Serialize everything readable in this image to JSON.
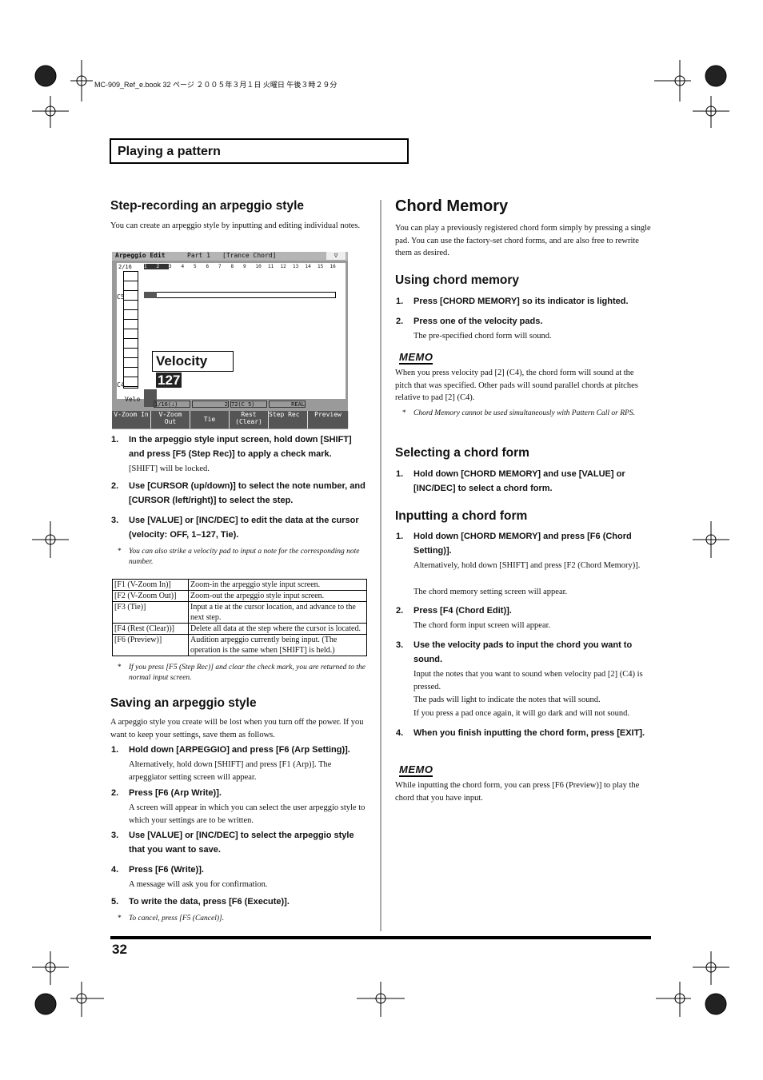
{
  "header": {
    "file_line": "MC-909_Ref_e.book  32 ページ  ２００５年３月１日  火曜日  午後３時２９分"
  },
  "section_title": "Playing a pattern",
  "left": {
    "h_step": "Step-recording an arpeggio style",
    "p_step": "You can create an arpeggio style by inputting and editing individual notes.",
    "lcd": {
      "title": "Arpeggio Edit",
      "part": "Part 1",
      "style": "[Trance Chord]",
      "position": "2/16",
      "steps": [
        "1",
        "2",
        "3",
        "4",
        "5",
        "6",
        "7",
        "8",
        "9",
        "10",
        "11",
        "12",
        "13",
        "14",
        "15",
        "16"
      ],
      "c5": "C5",
      "c4": "C4",
      "velo": "Velo",
      "velocity_label": "Velocity",
      "velocity_value": "127",
      "status": [
        "1/16(♩)",
        "2",
        "72(C 5)",
        "REAL"
      ],
      "fkeys": [
        "V-Zoom In",
        "V-Zoom Out",
        "Tie",
        "Rest (Clear)",
        "Step Rec",
        "Preview"
      ]
    },
    "steps1": [
      {
        "n": "1.",
        "text": "In the arpeggio style input screen, hold down [SHIFT] and press [F5 (Step Rec)] to apply a check mark.",
        "sub": "[SHIFT] will be locked."
      },
      {
        "n": "2.",
        "text": "Use [CURSOR (up/down)] to select the note number, and [CURSOR (left/right)] to select the step."
      },
      {
        "n": "3.",
        "text": "Use [VALUE] or [INC/DEC] to edit the data at the cursor (velocity: OFF, 1–127, Tie)."
      }
    ],
    "note1": "You can also strike a velocity pad to input a note for the corresponding note number.",
    "table": [
      [
        "[F1 (V-Zoom In)]",
        "Zoom-in the arpeggio style input screen."
      ],
      [
        "[F2 (V-Zoom Out)]",
        "Zoom-out the arpeggio style input screen."
      ],
      [
        "[F3 (Tie)]",
        "Input a tie at the cursor location, and advance to the next step."
      ],
      [
        "[F4 (Rest (Clear))]",
        "Delete all data at the step where the cursor is located."
      ],
      [
        "[F6 (Preview)]",
        "Audition arpeggio currently being input. (The operation is the same when [SHIFT] is held.)"
      ]
    ],
    "note2": "If you press [F5 (Step Rec)] and clear the check mark, you are returned to the normal input screen.",
    "h_save": "Saving an arpeggio style",
    "p_save": "A arpeggio style you create will be lost when you turn off the power. If you want to keep your settings, save them as follows.",
    "steps2": [
      {
        "n": "1.",
        "text": "Hold down [ARPEGGIO] and press [F6 (Arp Setting)].",
        "sub": "Alternatively, hold down [SHIFT] and press [F1 (Arp)]. The arpeggiator setting screen will appear."
      },
      {
        "n": "2.",
        "text": "Press [F6 (Arp Write)].",
        "sub": "A screen will appear in which you can select the user arpeggio style to which your settings are to be written."
      },
      {
        "n": "3.",
        "text": "Use [VALUE] or [INC/DEC] to select the arpeggio style that you want to save."
      },
      {
        "n": "4.",
        "text": "Press [F6 (Write)].",
        "sub": "A message will ask you for confirmation."
      },
      {
        "n": "5.",
        "text": "To write the data, press [F6 (Execute)]."
      }
    ],
    "note3": "To cancel, press [F5 (Cancel)]."
  },
  "right": {
    "h_chord": "Chord Memory",
    "p_chord": "You can play a previously registered chord form simply by pressing a single pad. You can use the factory-set chord forms, and are also free to rewrite them as desired.",
    "h_using": "Using chord memory",
    "using": [
      {
        "n": "1.",
        "text": "Press [CHORD MEMORY] so its indicator is lighted."
      },
      {
        "n": "2.",
        "text": "Press one of the velocity pads.",
        "sub": "The pre-specified chord form will sound."
      }
    ],
    "memo_label": "MEMO",
    "memo1": "When you press velocity pad [2] (C4), the chord form will sound at the pitch that was specified. Other pads will sound parallel chords at pitches relative to pad [2] (C4).",
    "note_using": "Chord Memory cannot be used simultaneously with Pattern Call or RPS.",
    "h_select": "Selecting a chord form",
    "select": [
      {
        "n": "1.",
        "text": "Hold down [CHORD MEMORY] and use [VALUE] or [INC/DEC] to select a chord form."
      }
    ],
    "h_input": "Inputting a chord form",
    "input": [
      {
        "n": "1.",
        "text": "Hold down [CHORD MEMORY] and press [F6 (Chord Setting)].",
        "sub": "Alternatively, hold down [SHIFT] and press [F2 (Chord Memory)].",
        "sub2": "The chord memory setting screen will appear."
      },
      {
        "n": "2.",
        "text": "Press [F4 (Chord Edit)].",
        "sub": "The chord form input screen will appear."
      },
      {
        "n": "3.",
        "text": "Use the velocity pads to input the chord you want to sound.",
        "sub": "Input the notes that you want to sound when velocity pad [2] (C4) is pressed.",
        "sub2": "The pads will light to indicate the notes that will sound.",
        "sub3": "If you press a pad once again, it will go dark and will not sound."
      },
      {
        "n": "4.",
        "text": "When you finish inputting the chord form, press [EXIT]."
      }
    ],
    "memo2": "While inputting the chord form, you can press [F6 (Preview)] to play the chord that you have input."
  },
  "footer": {
    "page_number": "32"
  }
}
